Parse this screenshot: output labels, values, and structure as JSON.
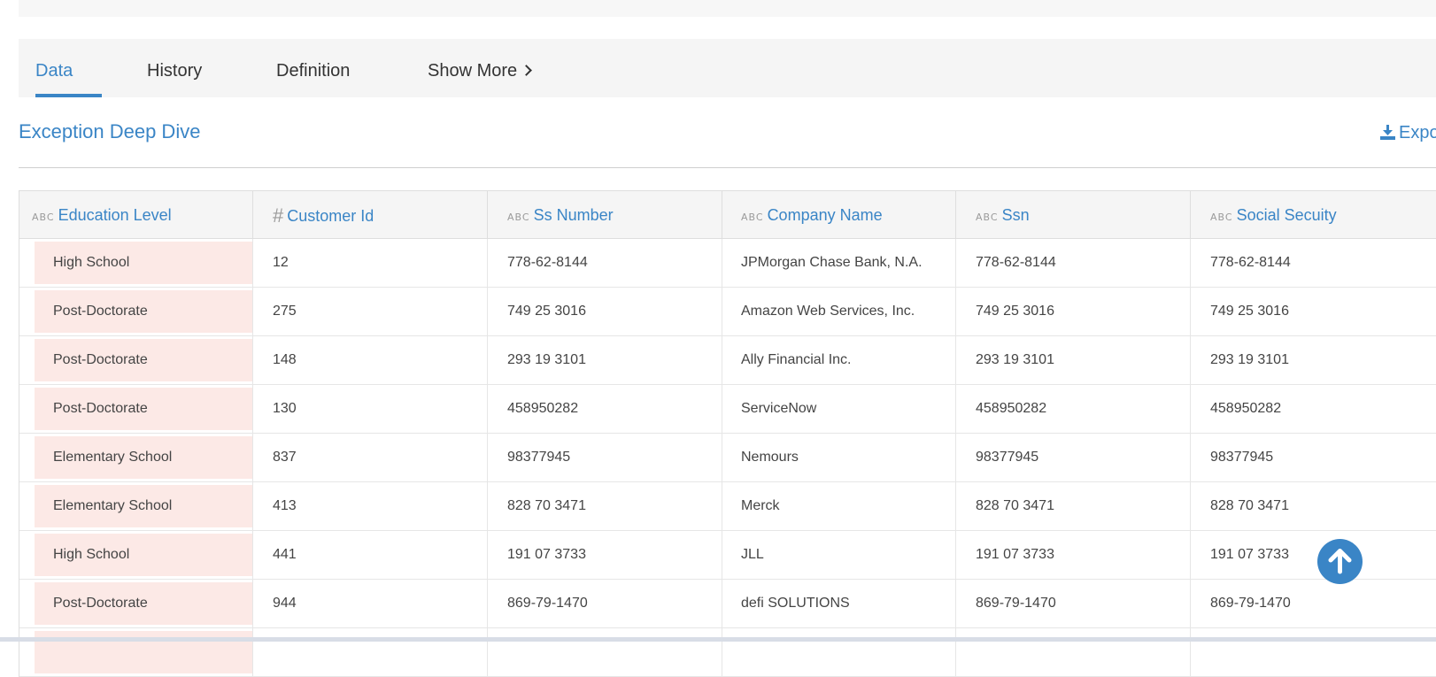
{
  "tabs": [
    {
      "label": "Data",
      "active": true
    },
    {
      "label": "History",
      "active": false
    },
    {
      "label": "Definition",
      "active": false
    },
    {
      "label": "Show More",
      "active": false
    }
  ],
  "section": {
    "title": "Exception Deep Dive",
    "export_label": "Expo"
  },
  "table": {
    "columns": [
      {
        "label": "Education Level",
        "type_icon": "ABC"
      },
      {
        "label": "Customer Id",
        "type_icon": "#"
      },
      {
        "label": "Ss Number",
        "type_icon": "ABC"
      },
      {
        "label": "Company Name",
        "type_icon": "ABC"
      },
      {
        "label": "Ssn",
        "type_icon": "ABC"
      },
      {
        "label": "Social Secuity",
        "type_icon": "ABC"
      }
    ],
    "rows": [
      [
        "High School",
        "12",
        "778-62-8144",
        "JPMorgan Chase Bank, N.A.",
        "778-62-8144",
        "778-62-8144"
      ],
      [
        "Post-Doctorate",
        "275",
        "749 25 3016",
        "Amazon Web Services, Inc.",
        "749 25 3016",
        "749 25 3016"
      ],
      [
        "Post-Doctorate",
        "148",
        "293 19 3101",
        "Ally Financial Inc.",
        "293 19 3101",
        "293 19 3101"
      ],
      [
        "Post-Doctorate",
        "130",
        "458950282",
        "ServiceNow",
        "458950282",
        "458950282"
      ],
      [
        "Elementary School",
        "837",
        "98377945",
        "Nemours",
        "98377945",
        "98377945"
      ],
      [
        "Elementary School",
        "413",
        "828 70 3471",
        "Merck",
        "828 70 3471",
        "828 70 3471"
      ],
      [
        "High School",
        "441",
        "191 07 3733",
        "JLL",
        "191 07 3733",
        "191 07 3733"
      ],
      [
        "Post-Doctorate",
        "944",
        "869-79-1470",
        "defi SOLUTIONS",
        "869-79-1470",
        "869-79-1470"
      ],
      [
        "",
        "",
        "",
        "",
        "",
        ""
      ]
    ]
  },
  "colors": {
    "accent": "#3a85c6",
    "exception_highlight": "#fce9e6"
  },
  "icons": {
    "export": "download-icon",
    "scroll_top": "arrow-up-icon",
    "show_more": "chevron-right-icon"
  }
}
